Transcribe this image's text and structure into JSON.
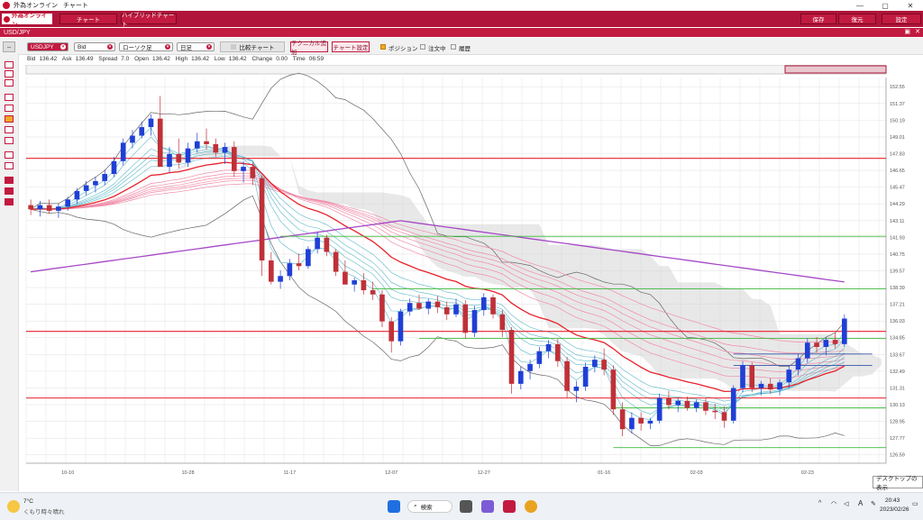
{
  "window": {
    "app_name": "外為オンライン",
    "title": "チャート"
  },
  "menu": {
    "logo_text": "外為オンライン",
    "chart_btn": "チャート",
    "hybrid_btn": "ハイブリッドチャート",
    "save_btn": "保存",
    "restore_btn": "復元",
    "settings_btn": "設定"
  },
  "pair_bar": {
    "pair": "USD/JPY"
  },
  "toolbar": {
    "pair_select": "USDJPY",
    "price_select": "Bid",
    "type_select": "ローソク足",
    "period_select": "日足",
    "compare_btn": "比較チャート",
    "tech_btn": "テクニカル追加",
    "chart_settings_btn": "チャート設定",
    "position_label": "ポジション",
    "order_label": "注文中",
    "history_label": "履歴"
  },
  "quote": {
    "bid_label": "Bid",
    "bid": "136.42",
    "ask_label": "Ask",
    "ask": "136.49",
    "spread_label": "Spread",
    "spread": "7.0",
    "open_label": "Open",
    "open": "136.42",
    "high_label": "High",
    "high": "136.42",
    "low_label": "Low",
    "low": "136.42",
    "change_label": "Change",
    "change": "0.00",
    "time_label": "Time",
    "time": "06:59"
  },
  "colors": {
    "accent": "#c21a40",
    "bull": "#1f3fd6",
    "bear": "#c03038",
    "hline_red": "#e8202a",
    "hline_green": "#3dbb3d",
    "hline_blue": "#3355aa",
    "ma_purple": "#a648c8",
    "ma_red": "#e8202a",
    "ichimoku_cloud": "#d6d6d6"
  },
  "chart_data": {
    "type": "candlestick",
    "title": "",
    "y_axis_labels": [
      "152.55",
      "151.37",
      "150.19",
      "149.01",
      "147.83",
      "146.65",
      "145.47",
      "144.29",
      "143.11",
      "141.93",
      "140.75",
      "139.57",
      "138.39",
      "137.21",
      "136.03",
      "134.85",
      "133.67",
      "132.49",
      "131.31",
      "130.13",
      "128.95",
      "127.77",
      "126.59"
    ],
    "ylim": [
      126.0,
      153.2
    ],
    "x_axis_labels": [
      "10-10",
      "10-28",
      "11-17",
      "12-07",
      "12-27",
      "01-16",
      "02-03",
      "02-23"
    ],
    "horizontal_lines": {
      "red": [
        147.5,
        135.3,
        130.6
      ],
      "green": [
        142.0,
        138.3,
        134.8,
        129.9,
        127.1
      ],
      "blue": [
        133.7,
        132.9
      ]
    },
    "candles": [
      [
        144.2,
        144.6,
        143.5,
        143.9
      ],
      [
        143.9,
        144.5,
        143.4,
        144.2
      ],
      [
        144.2,
        144.6,
        143.6,
        143.8
      ],
      [
        143.8,
        144.3,
        143.3,
        144.1
      ],
      [
        144.1,
        144.8,
        143.8,
        144.6
      ],
      [
        144.6,
        145.4,
        144.3,
        145.2
      ],
      [
        145.2,
        145.9,
        144.9,
        145.6
      ],
      [
        145.6,
        146.2,
        145.1,
        145.9
      ],
      [
        145.9,
        146.7,
        145.6,
        146.4
      ],
      [
        146.4,
        147.6,
        146.2,
        147.3
      ],
      [
        147.3,
        148.9,
        147.0,
        148.6
      ],
      [
        148.6,
        149.5,
        148.2,
        149.1
      ],
      [
        149.1,
        150.1,
        148.9,
        149.7
      ],
      [
        149.7,
        150.6,
        149.1,
        150.3
      ],
      [
        150.3,
        151.9,
        149.6,
        146.9
      ],
      [
        146.9,
        148.3,
        146.5,
        147.8
      ],
      [
        147.8,
        148.9,
        146.8,
        147.2
      ],
      [
        147.2,
        148.6,
        146.9,
        148.2
      ],
      [
        148.2,
        149.3,
        147.9,
        148.7
      ],
      [
        148.7,
        149.6,
        148.1,
        148.5
      ],
      [
        148.5,
        148.9,
        147.6,
        147.9
      ],
      [
        147.9,
        148.6,
        147.1,
        148.3
      ],
      [
        148.3,
        148.7,
        146.2,
        146.6
      ],
      [
        146.6,
        147.3,
        145.8,
        146.9
      ],
      [
        146.9,
        147.2,
        145.6,
        146.1
      ],
      [
        146.1,
        146.3,
        139.2,
        140.3
      ],
      [
        140.3,
        140.9,
        138.6,
        138.8
      ],
      [
        138.8,
        139.6,
        138.3,
        139.2
      ],
      [
        139.2,
        140.4,
        138.9,
        140.1
      ],
      [
        140.1,
        140.8,
        139.6,
        139.9
      ],
      [
        139.9,
        141.3,
        139.7,
        141.1
      ],
      [
        141.1,
        142.3,
        140.8,
        141.9
      ],
      [
        141.9,
        142.1,
        140.6,
        140.9
      ],
      [
        140.9,
        141.1,
        139.2,
        139.5
      ],
      [
        139.5,
        140.3,
        138.8,
        138.6
      ],
      [
        138.6,
        139.1,
        138.1,
        138.9
      ],
      [
        138.9,
        139.4,
        137.9,
        138.2
      ],
      [
        138.2,
        138.8,
        137.5,
        137.9
      ],
      [
        137.9,
        138.2,
        135.6,
        136.0
      ],
      [
        136.0,
        136.3,
        133.8,
        134.6
      ],
      [
        134.6,
        136.9,
        134.3,
        136.7
      ],
      [
        136.7,
        137.6,
        136.4,
        137.3
      ],
      [
        137.3,
        137.9,
        136.8,
        136.9
      ],
      [
        136.9,
        137.6,
        136.5,
        137.4
      ],
      [
        137.4,
        137.8,
        136.6,
        137.0
      ],
      [
        137.0,
        137.4,
        136.1,
        136.5
      ],
      [
        136.5,
        137.6,
        136.3,
        137.2
      ],
      [
        137.2,
        137.5,
        134.8,
        135.2
      ],
      [
        135.2,
        137.1,
        134.9,
        136.8
      ],
      [
        136.8,
        138.0,
        136.4,
        137.7
      ],
      [
        137.7,
        137.9,
        136.2,
        136.5
      ],
      [
        136.5,
        136.8,
        134.9,
        135.4
      ],
      [
        135.4,
        135.6,
        130.9,
        131.6
      ],
      [
        131.6,
        132.8,
        131.2,
        132.5
      ],
      [
        132.5,
        133.3,
        131.9,
        133.0
      ],
      [
        133.0,
        134.2,
        132.7,
        133.9
      ],
      [
        133.9,
        134.7,
        133.4,
        134.4
      ],
      [
        134.4,
        134.8,
        132.8,
        133.2
      ],
      [
        133.2,
        133.5,
        130.6,
        131.1
      ],
      [
        131.1,
        131.8,
        130.3,
        131.4
      ],
      [
        131.4,
        133.1,
        131.1,
        132.8
      ],
      [
        132.8,
        133.6,
        132.4,
        133.3
      ],
      [
        133.3,
        134.1,
        132.2,
        132.6
      ],
      [
        132.6,
        132.9,
        129.4,
        129.8
      ],
      [
        129.8,
        130.3,
        127.9,
        128.4
      ],
      [
        128.4,
        129.6,
        128.1,
        129.2
      ],
      [
        129.2,
        129.6,
        128.3,
        128.8
      ],
      [
        128.8,
        129.2,
        128.4,
        129.0
      ],
      [
        129.0,
        130.9,
        128.8,
        130.6
      ],
      [
        130.6,
        131.1,
        129.8,
        130.1
      ],
      [
        130.1,
        130.6,
        129.6,
        130.4
      ],
      [
        130.4,
        130.7,
        129.7,
        129.9
      ],
      [
        129.9,
        130.5,
        129.6,
        130.3
      ],
      [
        130.3,
        130.6,
        129.4,
        129.7
      ],
      [
        129.7,
        130.2,
        129.1,
        129.6
      ],
      [
        129.6,
        130.0,
        128.5,
        129.0
      ],
      [
        129.0,
        131.5,
        128.8,
        131.3
      ],
      [
        131.3,
        133.2,
        131.0,
        132.9
      ],
      [
        132.9,
        133.1,
        131.0,
        131.3
      ],
      [
        131.3,
        131.8,
        130.8,
        131.6
      ],
      [
        131.6,
        132.0,
        130.9,
        131.2
      ],
      [
        131.2,
        131.9,
        130.8,
        131.7
      ],
      [
        131.7,
        132.9,
        131.3,
        132.6
      ],
      [
        132.6,
        133.7,
        132.2,
        133.4
      ],
      [
        133.4,
        134.8,
        133.1,
        134.5
      ],
      [
        134.5,
        134.9,
        133.8,
        134.2
      ],
      [
        134.2,
        134.9,
        133.6,
        134.7
      ],
      [
        134.7,
        135.2,
        134.1,
        134.4
      ],
      [
        134.4,
        136.5,
        134.2,
        136.2
      ]
    ]
  },
  "taskbar": {
    "weather_temp": "7°C",
    "weather_desc": "くもり時々晴れ",
    "search": "検索",
    "time": "20:43",
    "date": "2023/02/26",
    "lang": "A"
  },
  "tooltip": {
    "text": "デスクトップの表示"
  }
}
